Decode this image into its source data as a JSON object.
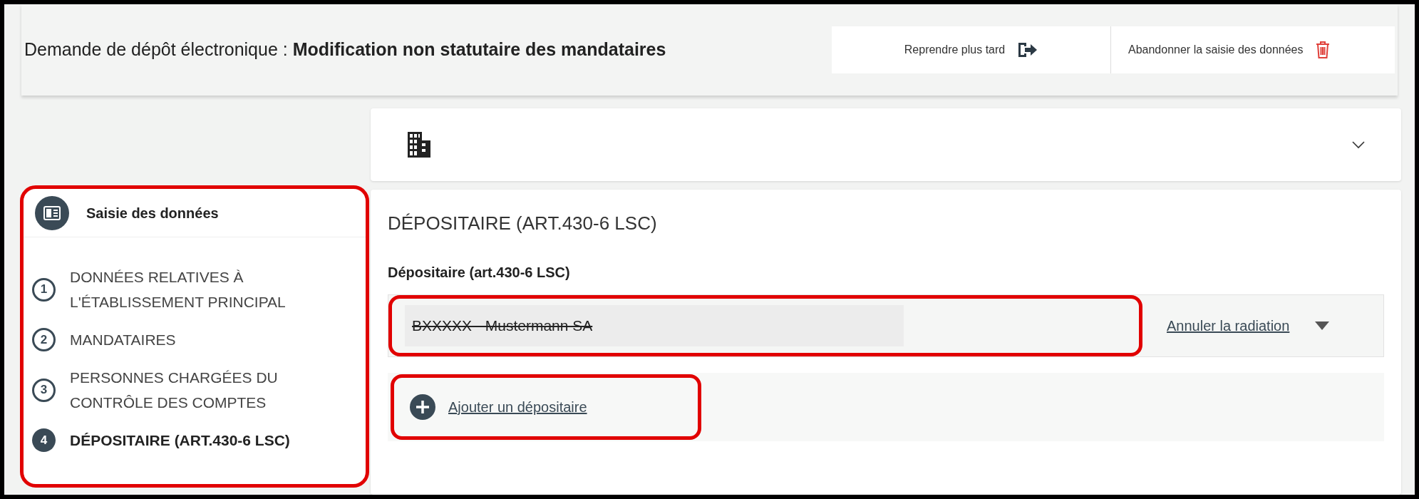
{
  "header": {
    "title_prefix": "Demande de dépôt électronique : ",
    "title_main": "Modification non statutaire des mandataires",
    "actions": [
      {
        "label": "Reprendre plus tard",
        "kind": "resume"
      },
      {
        "label": "Abandonner la saisie des données",
        "kind": "discard"
      }
    ]
  },
  "company_panel": {
    "expanded": false
  },
  "sidebar": {
    "heading": "Saisie des données",
    "steps": [
      {
        "number": "1",
        "label": "DONNÉES RELATIVES À L'ÉTABLISSEMENT PRINCIPAL",
        "selected": false
      },
      {
        "number": "2",
        "label": "MANDATAIRES",
        "selected": false
      },
      {
        "number": "3",
        "label": "PERSONNES CHARGÉES DU CONTRÔLE DES COMPTES",
        "selected": false
      },
      {
        "number": "4",
        "label": "DÉPOSITAIRE (ART.430-6 LSC)",
        "selected": true
      }
    ]
  },
  "section": {
    "title": "DÉPOSITAIRE (ART.430-6 LSC)",
    "field_label": "Dépositaire (art.430-6 LSC)",
    "entries": [
      {
        "value": "BXXXXX - Mustermann SA",
        "struck_out": true,
        "action": "Annuler la radiation",
        "expanded": false
      }
    ],
    "add_link": "Ajouter un dépositaire"
  }
}
